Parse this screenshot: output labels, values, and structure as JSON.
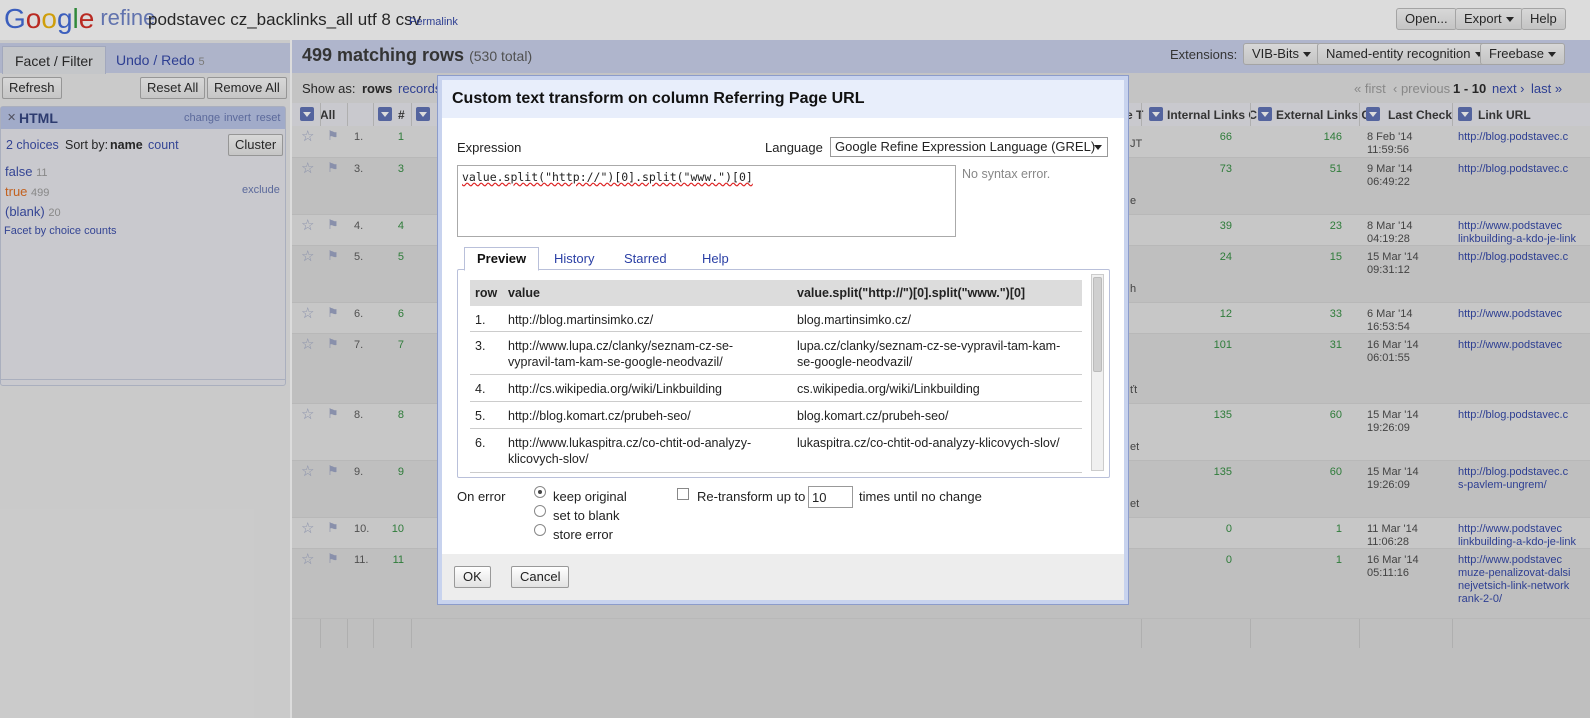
{
  "header": {
    "logo_google": "Google",
    "logo_refine": "refine",
    "project_name": "podstavec cz_backlinks_all utf 8 csv",
    "permalink": "Permalink",
    "open": "Open...",
    "export": "Export",
    "help": "Help"
  },
  "left": {
    "tab_facet": "Facet / Filter",
    "tab_undo": "Undo / Redo",
    "undo_count": "5",
    "refresh": "Refresh",
    "reset_all": "Reset All",
    "remove_all": "Remove All",
    "facet": {
      "title": "HTML",
      "change": "change",
      "invert": "invert",
      "reset": "reset",
      "choices": "2 choices",
      "sort_by": "Sort by:",
      "sort_name": "name",
      "sort_count": "count",
      "cluster": "Cluster",
      "items": [
        {
          "label": "false",
          "count": "11"
        },
        {
          "label": "true",
          "count": "499"
        },
        {
          "label": "(blank)",
          "count": "20"
        }
      ],
      "exclude": "exclude",
      "facet_by_counts": "Facet by choice counts"
    }
  },
  "main": {
    "matching": "499 matching rows",
    "total": "(530 total)",
    "extensions_label": "Extensions:",
    "ext_vib": "VIB-Bits",
    "ext_ner": "Named-entity recognition",
    "ext_freebase": "Freebase",
    "show_as": "Show as:",
    "rows": "rows",
    "records": "records",
    "pager": {
      "first": "« first",
      "previous": "‹ previous",
      "range": "1 - 10",
      "next": "next ›",
      "last": "last »"
    },
    "columns": {
      "all": "All",
      "hash": "#",
      "e": "e T",
      "internal": "Internal Links C",
      "external": "External Links C",
      "last_check": "Last Check",
      "link_url": "Link URL"
    },
    "rows_data": [
      {
        "idx": "1.",
        "n": "1",
        "mid": "JT",
        "internal": "66",
        "external": "146",
        "date": "8 Feb '14",
        "time": "11:59:56",
        "url1": "http://blog.podstavec.c",
        "url2": "",
        "url3": "",
        "url4": ""
      },
      {
        "idx": "3.",
        "n": "3",
        "mid": "e",
        "internal": "73",
        "external": "51",
        "date": "9 Mar '14",
        "time": "06:49:22",
        "url1": "http://blog.podstavec.c",
        "url2": "",
        "url3": "",
        "url4": ""
      },
      {
        "idx": "4.",
        "n": "4",
        "mid": "",
        "internal": "39",
        "external": "23",
        "date": "8 Mar '14",
        "time": "04:19:28",
        "url1": "http://www.podstavec",
        "url2": "linkbuilding-a-kdo-je-link",
        "url3": "",
        "url4": ""
      },
      {
        "idx": "5.",
        "n": "5",
        "mid": "h",
        "internal": "24",
        "external": "15",
        "date": "15 Mar '14",
        "time": "09:31:12",
        "url1": "http://blog.podstavec.c",
        "url2": "",
        "url3": "",
        "url4": ""
      },
      {
        "idx": "6.",
        "n": "6",
        "mid": "",
        "internal": "12",
        "external": "33",
        "date": "6 Mar '14",
        "time": "16:53:54",
        "url1": "http://www.podstavec",
        "url2": "",
        "url3": "",
        "url4": ""
      },
      {
        "idx": "7.",
        "n": "7",
        "mid": "ťt",
        "internal": "101",
        "external": "31",
        "date": "16 Mar '14",
        "time": "06:01:55",
        "url1": "http://www.podstavec",
        "url2": "",
        "url3": "",
        "url4": ""
      },
      {
        "idx": "8.",
        "n": "8",
        "mid": "et",
        "internal": "135",
        "external": "60",
        "date": "15 Mar '14",
        "time": "19:26:09",
        "url1": "http://blog.podstavec.c",
        "url2": "",
        "url3": "",
        "url4": ""
      },
      {
        "idx": "9.",
        "n": "9",
        "mid": "et",
        "internal": "135",
        "external": "60",
        "date": "15 Mar '14",
        "time": "19:26:09",
        "url1": "http://blog.podstavec.c",
        "url2": "s-pavlem-ungrem/",
        "url3": "",
        "url4": ""
      },
      {
        "idx": "10.",
        "n": "10",
        "mid": "",
        "internal": "0",
        "external": "1",
        "date": "11 Mar '14",
        "time": "11:06:28",
        "url1": "http://www.podstavec",
        "url2": "linkbuilding-a-kdo-je-link",
        "url3": "",
        "url4": ""
      },
      {
        "idx": "11.",
        "n": "11",
        "mid": "",
        "internal": "0",
        "external": "1",
        "date": "16 Mar '14",
        "time": "05:11:16",
        "url1": "http://www.podstavec",
        "url2": "muze-penalizovat-dalsi",
        "url3": "nejvetsich-link-network",
        "url4": "rank-2-0/"
      }
    ]
  },
  "dialog": {
    "title": "Custom text transform on column Referring Page URL",
    "expression_label": "Expression",
    "language_label": "Language",
    "language_value": "Google Refine Expression Language (GREL)",
    "expression": "value.split(\"http://\")[0].split(\"www.\")[0]",
    "syntax_status": "No syntax error.",
    "tabs": {
      "preview": "Preview",
      "history": "History",
      "starred": "Starred",
      "help": "Help"
    },
    "preview_header": {
      "row": "row",
      "value": "value",
      "result": "value.split(\"http://\")[0].split(\"www.\")[0]"
    },
    "preview_rows": [
      {
        "row": "1.",
        "value": "http://blog.martinsimko.cz/",
        "value2": "",
        "result": "blog.martinsimko.cz/",
        "result2": ""
      },
      {
        "row": "3.",
        "value": "http://www.lupa.cz/clanky/seznam-cz-se-",
        "value2": "vypravil-tam-kam-se-google-neodvazil/",
        "result": "lupa.cz/clanky/seznam-cz-se-vypravil-tam-kam-",
        "result2": "se-google-neodvazil/"
      },
      {
        "row": "4.",
        "value": "http://cs.wikipedia.org/wiki/Linkbuilding",
        "value2": "",
        "result": "cs.wikipedia.org/wiki/Linkbuilding",
        "result2": ""
      },
      {
        "row": "5.",
        "value": "http://blog.komart.cz/prubeh-seo/",
        "value2": "",
        "result": "blog.komart.cz/prubeh-seo/",
        "result2": ""
      },
      {
        "row": "6.",
        "value": "http://www.lukaspitra.cz/co-chtit-od-analyzy-",
        "value2": "klicovych-slov/",
        "result": "lukaspitra.cz/co-chtit-od-analyzy-klicovych-slov/",
        "result2": ""
      }
    ],
    "on_error_label": "On error",
    "on_error_options": [
      "keep original",
      "set to blank",
      "store error"
    ],
    "on_error_selected": "keep original",
    "retransform_label": "Re-transform up to",
    "retransform_value": "10",
    "retransform_suffix": "times until no change",
    "ok": "OK",
    "cancel": "Cancel"
  }
}
